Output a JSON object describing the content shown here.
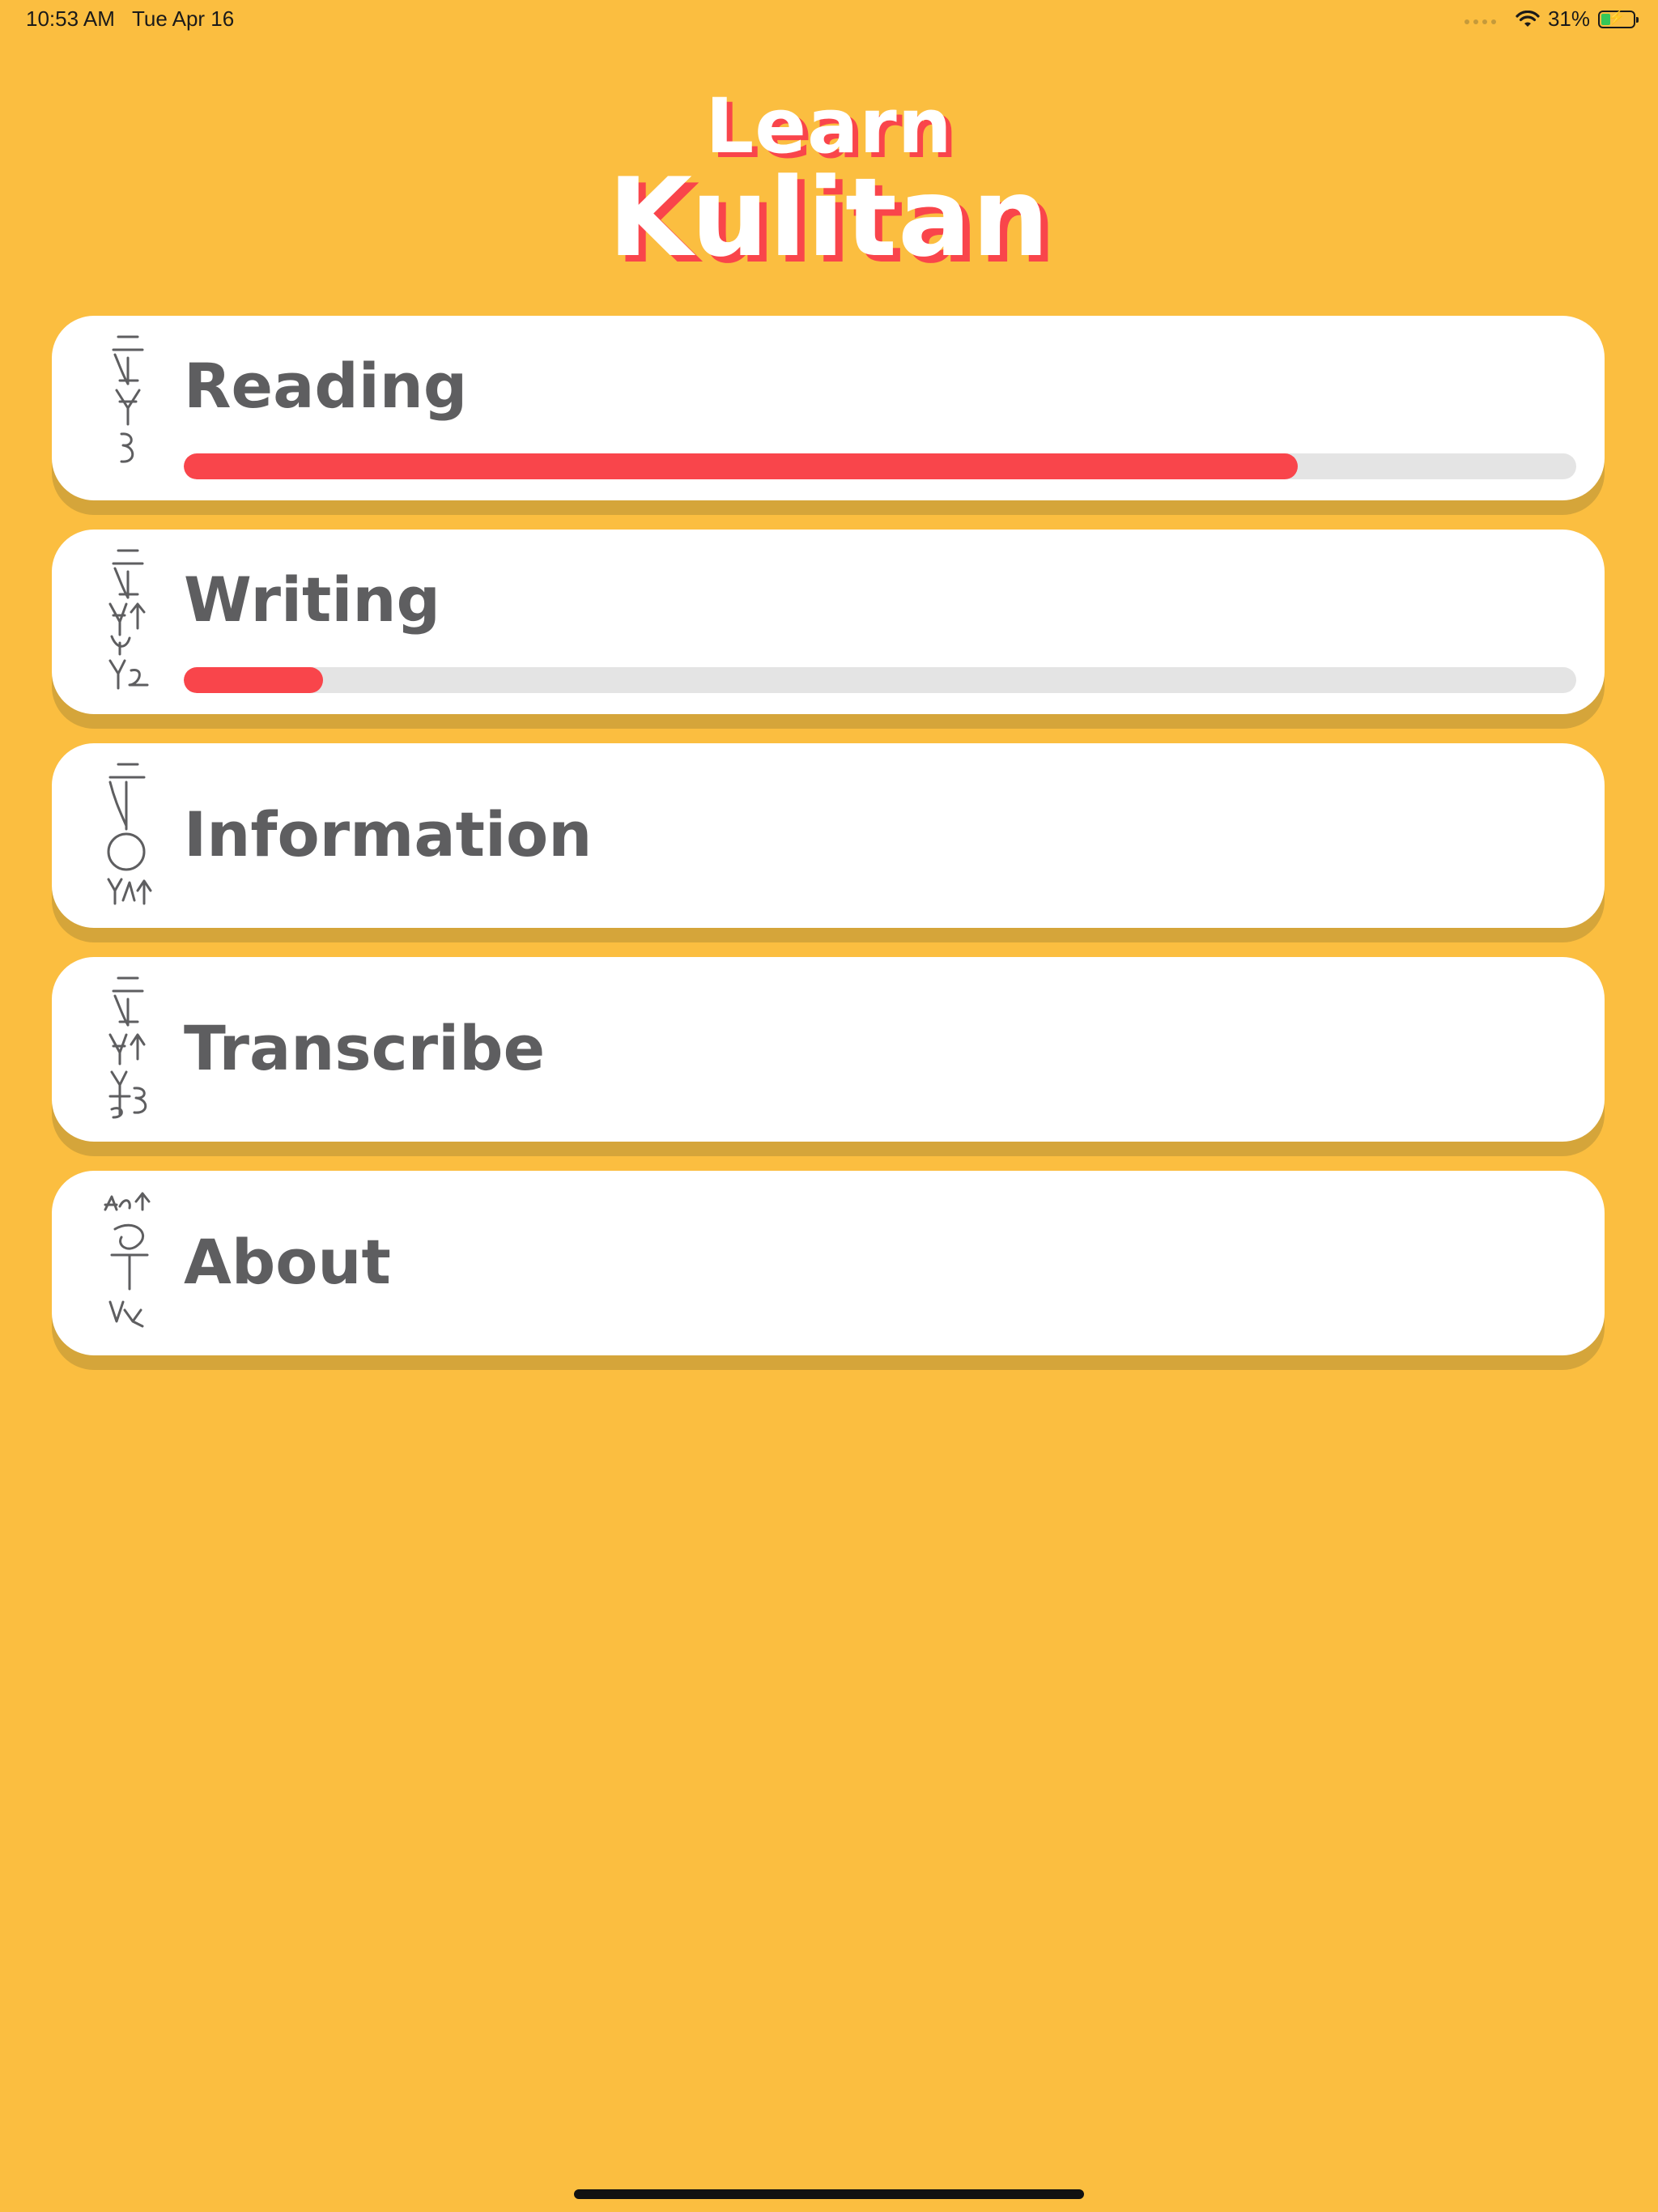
{
  "status_bar": {
    "time": "10:53 AM",
    "date": "Tue Apr 16",
    "battery_text": "31%",
    "battery_level": 0.31
  },
  "header": {
    "line1": "Learn",
    "line2": "Kulitan"
  },
  "menu": [
    {
      "label": "Reading",
      "progress": 0.8,
      "glyph": "kulitan-reading-glyph"
    },
    {
      "label": "Writing",
      "progress": 0.1,
      "glyph": "kulitan-writing-glyph"
    },
    {
      "label": "Information",
      "glyph": "kulitan-information-glyph"
    },
    {
      "label": "Transcribe",
      "glyph": "kulitan-transcribe-glyph"
    },
    {
      "label": "About",
      "glyph": "kulitan-about-glyph"
    }
  ],
  "colors": {
    "background": "#FBBE40",
    "accent": "#F9454B",
    "card": "#FFFFFF",
    "card_shadow": "#D5A53A",
    "label": "#5E5E60",
    "track": "#E4E4E4"
  }
}
